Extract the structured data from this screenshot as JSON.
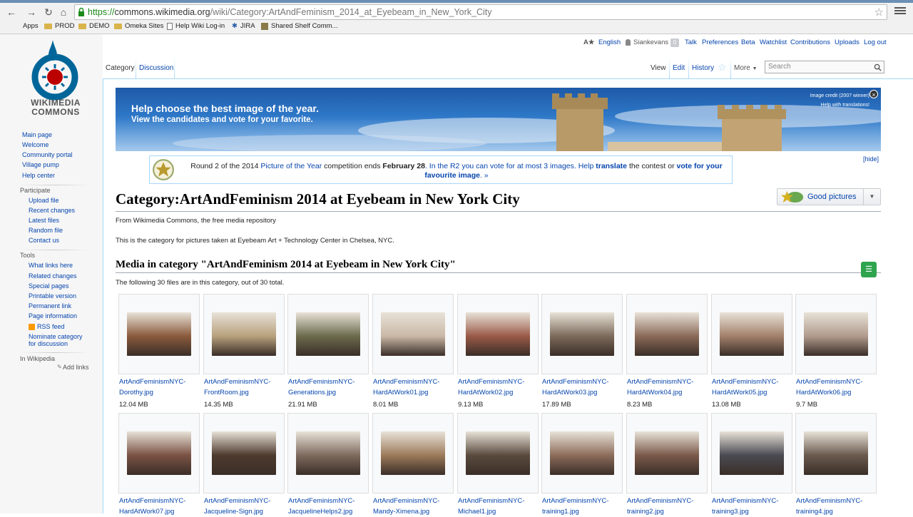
{
  "browser": {
    "url_scheme": "https://",
    "url_host": "commons.wikimedia.org",
    "url_path": "/wiki/Category:ArtAndFeminism_2014_at_Eyebeam_in_New_York_City",
    "bookmarks": [
      "Apps",
      "PROD",
      "DEMO",
      "Omeka Sites",
      "Help Wiki Log-in",
      "JIRA",
      "Shared Shelf Comm..."
    ]
  },
  "logo": {
    "line1": "WIKIMEDIA",
    "line2": "COMMONS"
  },
  "personal": {
    "language": "English",
    "user": "Siankevans",
    "notifications": "0",
    "links": [
      "Talk",
      "Preferences",
      "Beta",
      "Watchlist",
      "Contributions",
      "Uploads",
      "Log out"
    ]
  },
  "tabs": {
    "category": "Category",
    "discussion": "Discussion",
    "view": "View",
    "edit": "Edit",
    "history": "History",
    "more": "More",
    "search_placeholder": "Search"
  },
  "sidebar": {
    "nav": [
      "Main page",
      "Welcome",
      "Community portal",
      "Village pump",
      "Help center"
    ],
    "participate_heading": "Participate",
    "participate": [
      "Upload file",
      "Recent changes",
      "Latest files",
      "Random file",
      "Contact us"
    ],
    "tools_heading": "Tools",
    "tools": [
      "What links here",
      "Related changes",
      "Special pages",
      "Printable version",
      "Permanent link",
      "Page information",
      "RSS feed",
      "Nominate category",
      "for discussion"
    ],
    "wikipedia_heading": "In Wikipedia",
    "add_links": "Add links"
  },
  "banner": {
    "line1": "Help choose the best image of the year.",
    "line2": "View the candidates and vote for your favorite.",
    "credit": "Image credit (2007 winner)",
    "translate": "Help with translations!"
  },
  "notice": {
    "p1": "Round 2 of the 2014 ",
    "poty": "Picture of the Year",
    "p2": " competition ends ",
    "date": "February 28",
    "p3": ". In the R2 you can vote for at most 3 images. Help ",
    "translate": "translate",
    "p4": " the contest or ",
    "vote": "vote for your favourite image",
    "p5": ". »",
    "hide": "[hide]"
  },
  "page": {
    "title": "Category:ArtAndFeminism 2014 at Eyebeam in New York City",
    "from": "From Wikimedia Commons, the free media repository",
    "description": "This is the category for pictures taken at Eyebeam Art + Technology Center in Chelsea, NYC.",
    "good_pictures": "Good pictures",
    "media_heading": "Media in category \"ArtAndFeminism 2014 at Eyebeam in New York City\"",
    "count_text": "The following 30 files are in this category, out of 30 total."
  },
  "files": [
    {
      "name1": "ArtAndFeminismNYC-",
      "name2": "Dorothy.jpg",
      "size": "12.04 MB",
      "tone": "#8a5a3c"
    },
    {
      "name1": "ArtAndFeminismNYC-",
      "name2": "FrontRoom.jpg",
      "size": "14.35 MB",
      "tone": "#b7a07c"
    },
    {
      "name1": "ArtAndFeminismNYC-",
      "name2": "Generations.jpg",
      "size": "21.91 MB",
      "tone": "#6b6a4c"
    },
    {
      "name1": "ArtAndFeminismNYC-",
      "name2": "HardAtWork01.jpg",
      "size": "8.01 MB",
      "tone": "#c9b8a6"
    },
    {
      "name1": "ArtAndFeminismNYC-",
      "name2": "HardAtWork02.jpg",
      "size": "9.13 MB",
      "tone": "#9a5a48"
    },
    {
      "name1": "ArtAndFeminismNYC-",
      "name2": "HardAtWork03.jpg",
      "size": "17.89 MB",
      "tone": "#7c6a5a"
    },
    {
      "name1": "ArtAndFeminismNYC-",
      "name2": "HardAtWork04.jpg",
      "size": "8.23 MB",
      "tone": "#8a6a58"
    },
    {
      "name1": "ArtAndFeminismNYC-",
      "name2": "HardAtWork05.jpg",
      "size": "13.08 MB",
      "tone": "#a2806a"
    },
    {
      "name1": "ArtAndFeminismNYC-",
      "name2": "HardAtWork06.jpg",
      "size": "9.7 MB",
      "tone": "#b09a8c"
    },
    {
      "name1": "ArtAndFeminismNYC-",
      "name2": "HardAtWork07.jpg",
      "size": "",
      "tone": "#7a5244"
    },
    {
      "name1": "ArtAndFeminismNYC-",
      "name2": "Jacqueline-Sign.jpg",
      "size": "",
      "tone": "#4e3a2e"
    },
    {
      "name1": "ArtAndFeminismNYC-",
      "name2": "JacquelineHelps2.jpg",
      "size": "",
      "tone": "#7e6a5e"
    },
    {
      "name1": "ArtAndFeminismNYC-",
      "name2": "Mandy-Ximena.jpg",
      "size": "",
      "tone": "#9c7a5a"
    },
    {
      "name1": "ArtAndFeminismNYC-",
      "name2": "Michael1.jpg",
      "size": "",
      "tone": "#5a4a3e"
    },
    {
      "name1": "ArtAndFeminismNYC-",
      "name2": "training1.jpg",
      "size": "",
      "tone": "#8c6c5a"
    },
    {
      "name1": "ArtAndFeminismNYC-",
      "name2": "training2.jpg",
      "size": "",
      "tone": "#7a5a4a"
    },
    {
      "name1": "ArtAndFeminismNYC-",
      "name2": "training3.jpg",
      "size": "",
      "tone": "#4a4a52"
    },
    {
      "name1": "ArtAndFeminismNYC-",
      "name2": "training4.jpg",
      "size": "",
      "tone": "#6a5a4e"
    }
  ]
}
